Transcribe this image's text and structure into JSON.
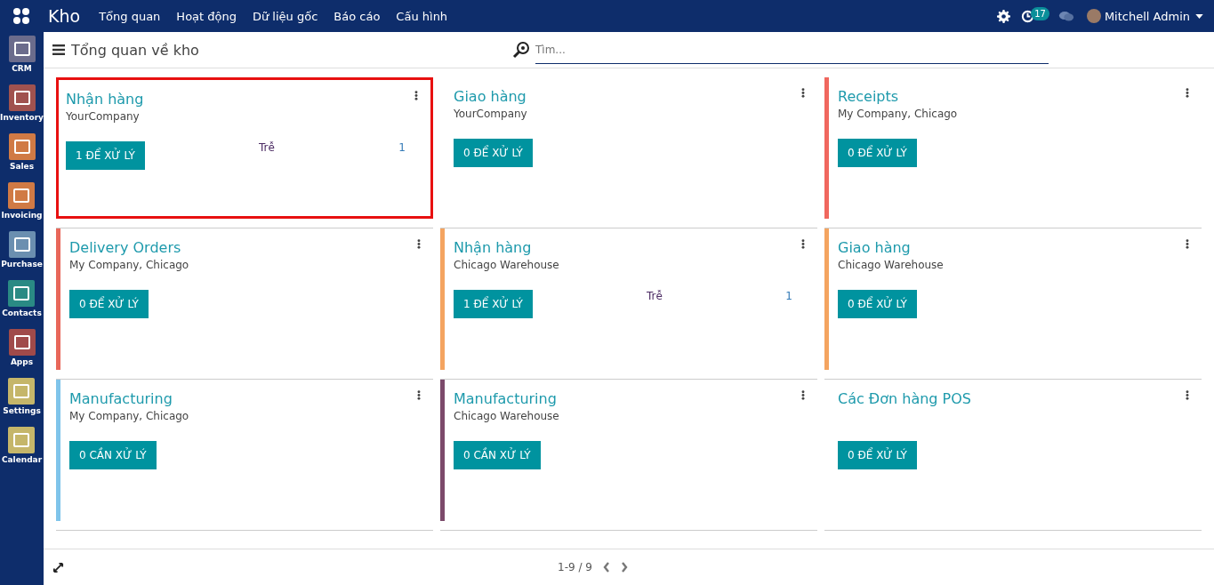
{
  "navbar": {
    "app_name": "Kho",
    "menu": [
      "Tổng quan",
      "Hoạt động",
      "Dữ liệu gốc",
      "Báo cáo",
      "Cấu hình"
    ],
    "activity_count": "17",
    "user": "Mitchell Admin"
  },
  "sidebar": {
    "items": [
      {
        "label": "CRM",
        "color": "#6b6c8c"
      },
      {
        "label": "Inventory",
        "color": "#a0524f"
      },
      {
        "label": "Sales",
        "color": "#d07a45"
      },
      {
        "label": "Invoicing",
        "color": "#d07a45"
      },
      {
        "label": "Purchase",
        "color": "#6b8fb0"
      },
      {
        "label": "Contacts",
        "color": "#2a8a84"
      },
      {
        "label": "Apps",
        "color": "#a04a4a"
      },
      {
        "label": "Settings",
        "color": "#c5b66a"
      },
      {
        "label": "Calendar",
        "color": "#c5b66a"
      }
    ]
  },
  "control_panel": {
    "title": "Tổng quan về kho",
    "search": {
      "placeholder": "Tìm..."
    }
  },
  "cards": [
    {
      "title": "Nhận hàng",
      "subtitle": "YourCompany",
      "button": "1 ĐỂ XỬ LÝ",
      "late_label": "Trễ",
      "late_count": "1",
      "highlighted": true
    },
    {
      "title": "Giao hàng",
      "subtitle": "YourCompany",
      "button": "0 ĐỂ XỬ LÝ",
      "highlighted": false
    },
    {
      "title": "Receipts",
      "subtitle": "My Company, Chicago",
      "button": "0 ĐỂ XỬ LÝ",
      "color": "#f0675e",
      "highlighted": false
    },
    {
      "title": "Delivery Orders",
      "subtitle": "My Company, Chicago",
      "button": "0 ĐỂ XỬ LÝ",
      "color": "#e8675a",
      "highlighted": false
    },
    {
      "title": "Nhận hàng",
      "subtitle": "Chicago Warehouse",
      "button": "1 ĐỂ XỬ LÝ",
      "late_label": "Trễ",
      "late_count": "1",
      "color": "#f4a460",
      "highlighted": false
    },
    {
      "title": "Giao hàng",
      "subtitle": "Chicago Warehouse",
      "button": "0 ĐỂ XỬ LÝ",
      "color": "#f4a460",
      "highlighted": false
    },
    {
      "title": "Manufacturing",
      "subtitle": "My Company, Chicago",
      "button": "0 CẦN XỬ LÝ",
      "color": "#7fc4ea",
      "highlighted": false
    },
    {
      "title": "Manufacturing",
      "subtitle": "Chicago Warehouse",
      "button": "0 CẦN XỬ LÝ",
      "color": "#7c4a6b",
      "highlighted": false
    },
    {
      "title": "Các Đơn hàng POS",
      "button": "0 ĐỂ XỬ LÝ",
      "highlighted": false
    }
  ],
  "pager": {
    "range": "1-9 / 9"
  }
}
